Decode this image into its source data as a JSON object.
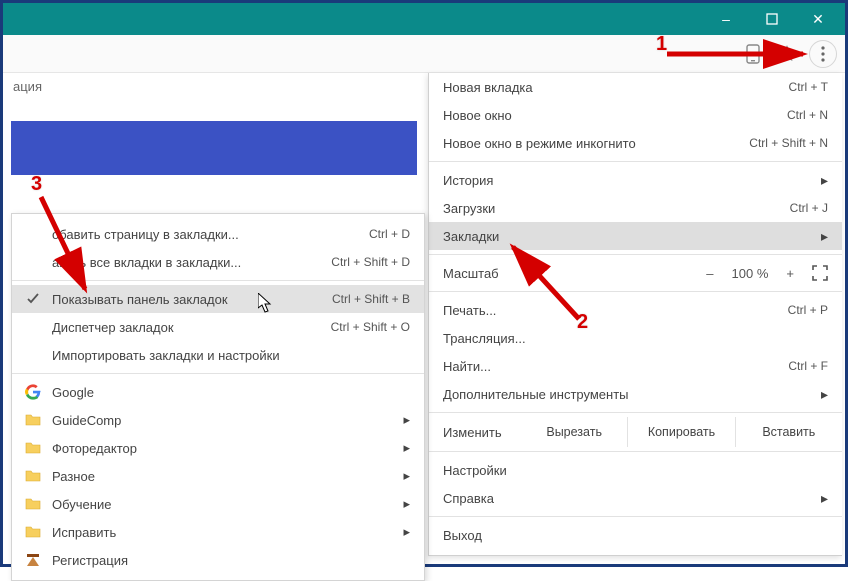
{
  "window": {
    "minimize": "–",
    "maximize": "□",
    "close": "✕"
  },
  "page": {
    "visible_text": "ация"
  },
  "toolbar": {
    "star_icon": "☆",
    "device_icon": "▭"
  },
  "main_menu": {
    "new_tab": {
      "label": "Новая вкладка",
      "shortcut": "Ctrl + T"
    },
    "new_window": {
      "label": "Новое окно",
      "shortcut": "Ctrl + N"
    },
    "incognito": {
      "label": "Новое окно в режиме инкогнито",
      "shortcut": "Ctrl + Shift + N"
    },
    "history": {
      "label": "История"
    },
    "downloads": {
      "label": "Загрузки",
      "shortcut": "Ctrl + J"
    },
    "bookmarks": {
      "label": "Закладки"
    },
    "zoom": {
      "label": "Масштаб",
      "value": "100 %",
      "minus": "–",
      "plus": "+"
    },
    "print": {
      "label": "Печать...",
      "shortcut": "Ctrl + P"
    },
    "cast": {
      "label": "Трансляция..."
    },
    "find": {
      "label": "Найти...",
      "shortcut": "Ctrl + F"
    },
    "tools": {
      "label": "Дополнительные инструменты"
    },
    "edit": {
      "label": "Изменить",
      "cut": "Вырезать",
      "copy": "Копировать",
      "paste": "Вставить"
    },
    "settings": {
      "label": "Настройки"
    },
    "help": {
      "label": "Справка"
    },
    "exit": {
      "label": "Выход"
    }
  },
  "sub_menu": {
    "add_page": {
      "label": "обавить страницу в закладки...",
      "shortcut": "Ctrl + D"
    },
    "add_all": {
      "label": "авить все вкладки в закладки...",
      "shortcut": "Ctrl + Shift + D"
    },
    "show_bar": {
      "label": "Показывать панель закладок",
      "shortcut": "Ctrl + Shift + B"
    },
    "manager": {
      "label": "Диспетчер закладок",
      "shortcut": "Ctrl + Shift + O"
    },
    "import": {
      "label": "Импортировать закладки и настройки"
    },
    "google": {
      "label": "Google"
    },
    "guidecomp": {
      "label": "GuideComp"
    },
    "photo": {
      "label": "Фоторедактор"
    },
    "misc": {
      "label": "Разное"
    },
    "learn": {
      "label": "Обучение"
    },
    "fix": {
      "label": "Исправить"
    },
    "reg": {
      "label": "Регистрация"
    }
  },
  "markers": {
    "m1": "1",
    "m2": "2",
    "m3": "3"
  }
}
